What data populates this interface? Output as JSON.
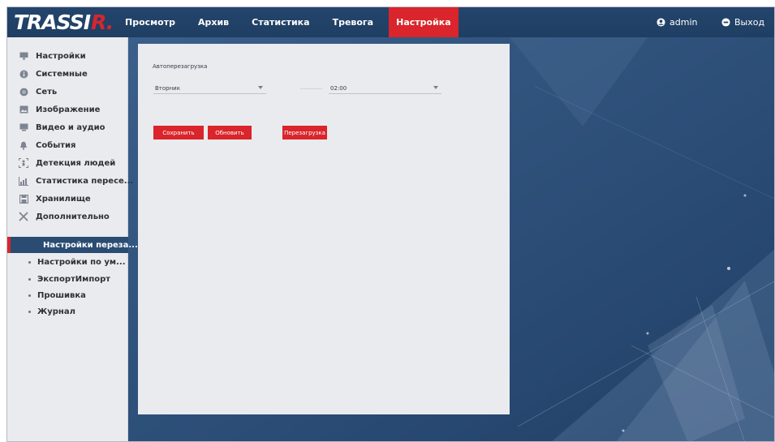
{
  "logo": {
    "main": "TRASSI",
    "accent": "R."
  },
  "nav": {
    "tabs": [
      {
        "label": "Просмотр",
        "active": false
      },
      {
        "label": "Архив",
        "active": false
      },
      {
        "label": "Статистика",
        "active": false
      },
      {
        "label": "Тревога",
        "active": false
      },
      {
        "label": "Настройка",
        "active": true
      }
    ],
    "user": "admin",
    "logout": "Выход"
  },
  "sidebar": {
    "items": [
      {
        "label": "Настройки",
        "icon": "monitor-icon"
      },
      {
        "label": "Системные",
        "icon": "info-icon"
      },
      {
        "label": "Сеть",
        "icon": "globe-icon"
      },
      {
        "label": "Изображение",
        "icon": "image-icon"
      },
      {
        "label": "Видео и аудио",
        "icon": "video-icon"
      },
      {
        "label": "События",
        "icon": "bell-icon"
      },
      {
        "label": "Детекция людей",
        "icon": "person-detect-icon"
      },
      {
        "label": "Статистика пересе...",
        "icon": "chart-icon"
      },
      {
        "label": "Хранилище",
        "icon": "storage-icon"
      },
      {
        "label": "Дополнительно",
        "icon": "tools-icon"
      }
    ],
    "subitems": [
      {
        "label": "Настройки переза...",
        "active": true
      },
      {
        "label": "Настройки по ум...",
        "active": false
      },
      {
        "label": "ЭкспортИмпорт",
        "active": false
      },
      {
        "label": "Прошивка",
        "active": false
      },
      {
        "label": "Журнал",
        "active": false
      }
    ]
  },
  "panel": {
    "title": "Автоперезагрузка",
    "day_select": "Вторник",
    "time_select": "02:00",
    "save_label": "Сохранить",
    "refresh_label": "Обновить",
    "reboot_label": "Перезагрузка"
  },
  "colors": {
    "accent": "#d9252b",
    "header": "#22426a",
    "sidebar": "#eaebee",
    "panel": "#eaebef"
  }
}
